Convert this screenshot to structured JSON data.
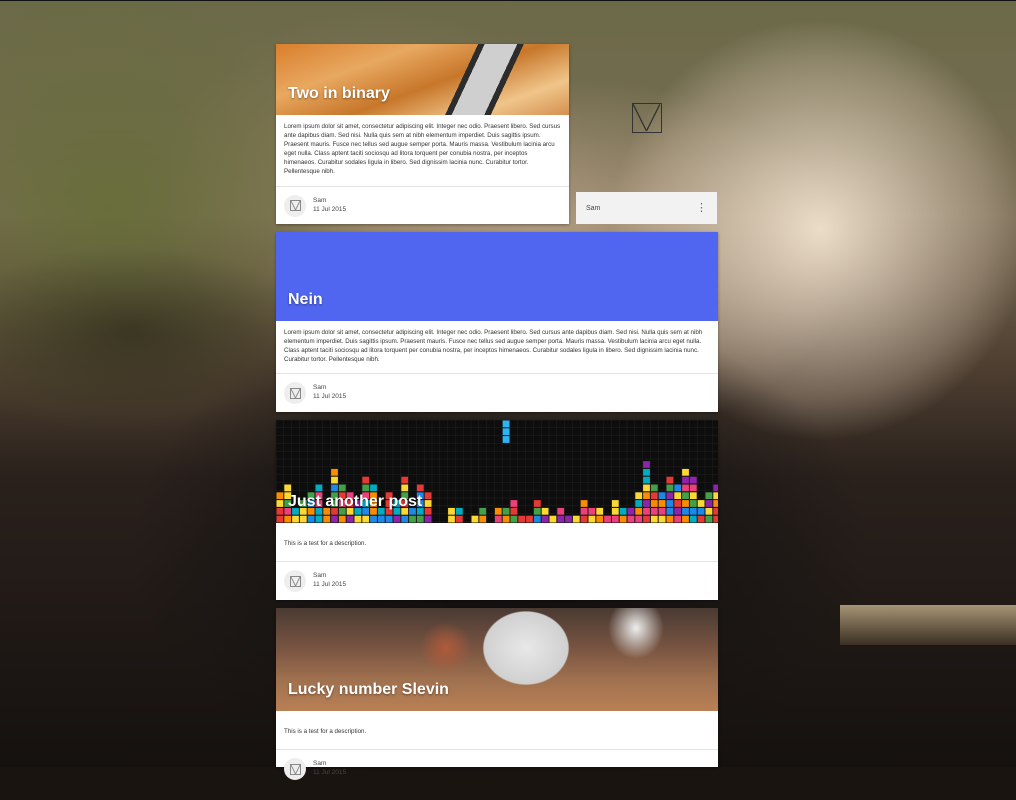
{
  "side_panel": {
    "author": "Sam",
    "menu_icon": "kebab-icon",
    "logo_icon": "logo-icon"
  },
  "posts": [
    {
      "title": "Two in binary",
      "excerpt": "Lorem ipsum dolor sit amet, consectetur adipiscing elit. Integer nec odio. Praesent libero. Sed cursus ante dapibus diam. Sed nisi. Nulla quis sem at nibh elementum imperdiet. Duis sagittis ipsum. Praesent mauris. Fusce nec tellus sed augue semper porta. Mauris massa. Vestibulum lacinia arcu eget nulla. Class aptent taciti sociosqu ad litora torquent per conubia nostra, per inceptos himenaeos. Curabitur sodales ligula in libero. Sed dignissim lacinia nunc. Curabitur tortor. Pellentesque nibh.",
      "author": "Sam",
      "date": "11 Jul 2015"
    },
    {
      "title": "Nein",
      "excerpt": "Lorem ipsum dolor sit amet, consectetur adipiscing elit. Integer nec odio. Praesent libero. Sed cursus ante dapibus diam. Sed nisi. Nulla quis sem at nibh elementum imperdiet. Duis sagittis ipsum. Praesent mauris. Fusce nec tellus sed augue semper porta. Mauris massa. Vestibulum lacinia arcu eget nulla. Class aptent taciti sociosqu ad litora torquent per conubia nostra, per inceptos himenaeos. Curabitur sodales ligula in libero. Sed dignissim lacinia nunc. Curabitur tortor. Pellentesque nibh.",
      "author": "Sam",
      "date": "11 Jul 2015",
      "hero_color": "#5066f0"
    },
    {
      "title": "Just another post",
      "excerpt": "This is a test for a description.",
      "author": "Sam",
      "date": "11 Jul 2015"
    },
    {
      "title": "Lucky number Slevin",
      "excerpt": "This is a test for a description.",
      "author": "Sam",
      "date": "11 Jul 2015"
    }
  ]
}
